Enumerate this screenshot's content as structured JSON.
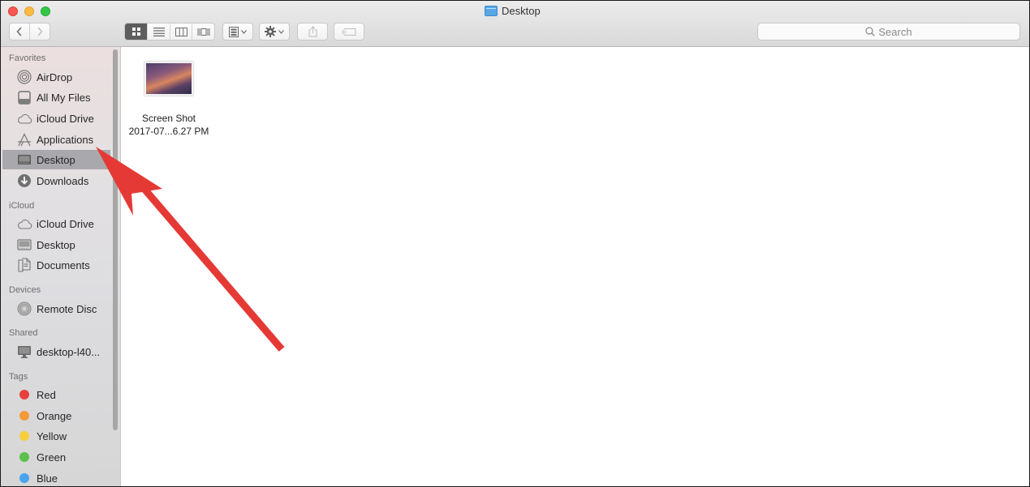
{
  "window": {
    "title": "Desktop",
    "title_icon": "folder-icon"
  },
  "toolbar": {
    "back_icon": "‹",
    "forward_icon": "›",
    "view_modes": [
      {
        "name": "icon-view",
        "selected": true
      },
      {
        "name": "list-view",
        "selected": false
      },
      {
        "name": "column-view",
        "selected": false
      },
      {
        "name": "cover-flow-view",
        "selected": false
      }
    ],
    "arrange_icon": "arrange-icon",
    "action_icon": "gear-icon",
    "share_icon": "share-icon",
    "tag_icon": "tag-icon",
    "search_placeholder": "Search"
  },
  "sidebar": {
    "sections": [
      {
        "label": "Favorites",
        "items": [
          {
            "label": "AirDrop",
            "icon": "airdrop-icon"
          },
          {
            "label": "All My Files",
            "icon": "all-files-icon"
          },
          {
            "label": "iCloud Drive",
            "icon": "cloud-icon"
          },
          {
            "label": "Applications",
            "icon": "applications-icon"
          },
          {
            "label": "Desktop",
            "icon": "desktop-icon",
            "selected": true
          },
          {
            "label": "Downloads",
            "icon": "downloads-icon"
          }
        ]
      },
      {
        "label": "iCloud",
        "items": [
          {
            "label": "iCloud Drive",
            "icon": "cloud-icon"
          },
          {
            "label": "Desktop",
            "icon": "desktop-icon"
          },
          {
            "label": "Documents",
            "icon": "documents-icon"
          }
        ]
      },
      {
        "label": "Devices",
        "items": [
          {
            "label": "Remote Disc",
            "icon": "disc-icon"
          }
        ]
      },
      {
        "label": "Shared",
        "items": [
          {
            "label": "desktop-l40...",
            "icon": "computer-icon"
          }
        ]
      },
      {
        "label": "Tags",
        "items": [
          {
            "label": "Red",
            "color": "#e8403c"
          },
          {
            "label": "Orange",
            "color": "#f49a3a"
          },
          {
            "label": "Yellow",
            "color": "#f7cd3d"
          },
          {
            "label": "Green",
            "color": "#5ac24a"
          },
          {
            "label": "Blue",
            "color": "#4aa3ee"
          }
        ]
      }
    ]
  },
  "content": {
    "files": [
      {
        "name_line1": "Screen Shot",
        "name_line2": "2017-07...6.27 PM",
        "type": "image"
      }
    ]
  },
  "annotation": {
    "type": "arrow",
    "color": "#e53935",
    "points_to": "Applications / Desktop sidebar item"
  }
}
